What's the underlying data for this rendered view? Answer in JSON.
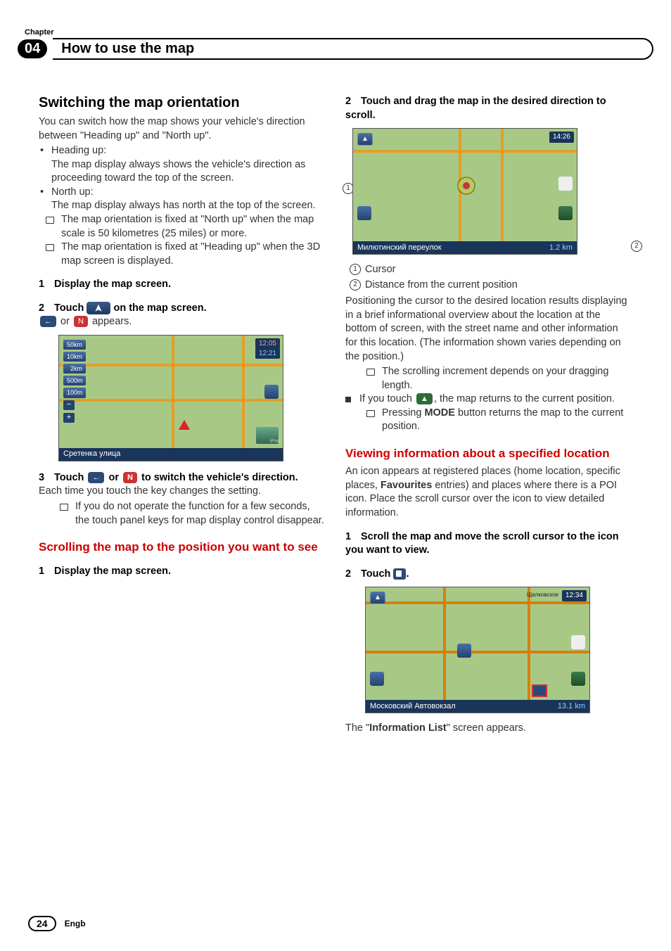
{
  "header": {
    "chapter_label": "Chapter",
    "chapter_number": "04",
    "title": "How to use the map"
  },
  "left": {
    "h2_switching": "Switching the map orientation",
    "intro": "You can switch how the map shows your vehicle's direction between \"Heading up\" and \"North up\".",
    "b1_label": "Heading up:",
    "b1_text": "The map display always shows the vehicle's direction as proceeding toward the top of the screen.",
    "b2_label": "North up:",
    "b2_text": "The map display always has north at the top of the screen.",
    "note1": "The map orientation is fixed at \"North up\" when the map scale is 50 kilometres (25 miles) or more.",
    "note2": "The map orientation is fixed at \"Heading up\" when the 3D map screen is displayed.",
    "step1": "Display the map screen.",
    "step2_a": "Touch ",
    "step2_b": " on the map screen.",
    "step2_sub_a": " or ",
    "step2_sub_b": " appears.",
    "fig1": {
      "scales": [
        "50km",
        "10km",
        "2km",
        "500m",
        "100m"
      ],
      "clock1": "12:05",
      "clock2": "12:21",
      "street": "Сретенка улица",
      "ipod": "iPod"
    },
    "step3_a": "Touch ",
    "step3_b": " or ",
    "step3_c": " to switch the vehicle's direction.",
    "step3_body": "Each time you touch the key changes the setting.",
    "step3_note": "If you do not operate the function for a few seconds, the touch panel keys for map display control disappear.",
    "h3_scroll": "Scrolling the map to the position you want to see",
    "scroll_step1": "Display the map screen."
  },
  "right": {
    "step2": "Touch and drag the map in the desired direction to scroll.",
    "fig2": {
      "clock": "14:26",
      "street": "Милютинский переулок",
      "distance": "1.2 km"
    },
    "legend1": "Cursor",
    "legend2": "Distance from the current position",
    "para1": "Positioning the cursor to the desired location results displaying in a brief informational overview about the location at the bottom of screen, with the street name and other information for this location. (The information shown varies depending on the position.)",
    "note_scroll": "The scrolling increment depends on your dragging length.",
    "tip_a": "If you touch ",
    "tip_b": ", the map returns to the current position.",
    "note_mode_a": "Pressing ",
    "note_mode_b": "MODE",
    "note_mode_c": " button returns the map to the current position.",
    "h3_view": "Viewing information about a specified location",
    "view_para": "An icon appears at registered places (home location, specific places, ",
    "view_para_bold": "Favourites",
    "view_para2": " entries) and places where there is a POI icon. Place the scroll cursor over the icon to view detailed information.",
    "view_step1": "Scroll the map and move the scroll cursor to the icon you want to view.",
    "view_step2": "Touch ",
    "fig3": {
      "topright": "Щелковское",
      "clock": "12:34",
      "street": "Московский Автовокзал",
      "distance": "13.1 km"
    },
    "closing_a": "The \"",
    "closing_b": "Information List",
    "closing_c": "\" screen appears."
  },
  "footer": {
    "page": "24",
    "lang": "Engb"
  },
  "labels": {
    "one": "1",
    "two": "2"
  }
}
